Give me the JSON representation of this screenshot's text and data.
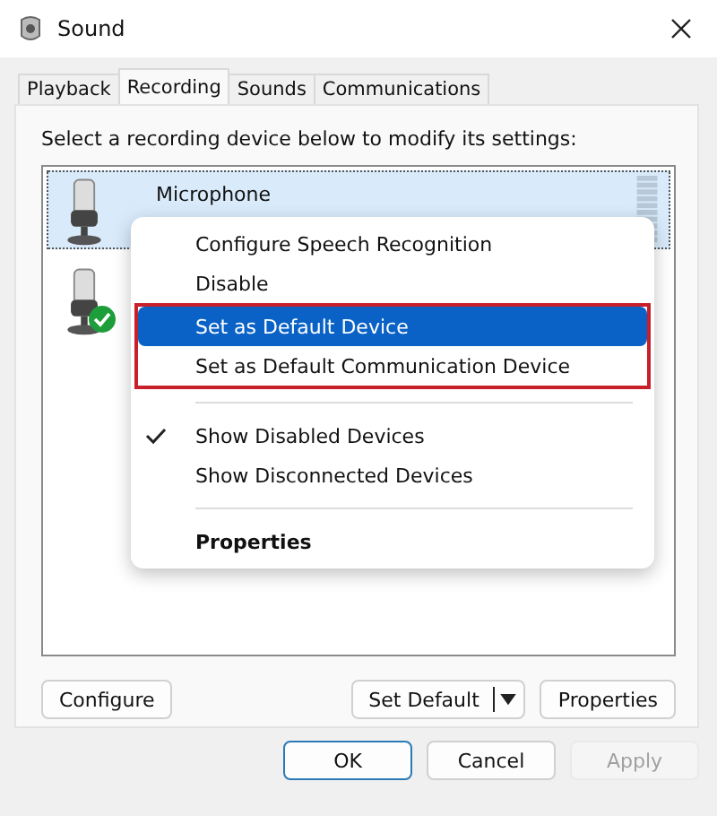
{
  "window": {
    "title": "Sound"
  },
  "tabs": [
    {
      "label": "Playback",
      "selected": false
    },
    {
      "label": "Recording",
      "selected": true
    },
    {
      "label": "Sounds",
      "selected": false
    },
    {
      "label": "Communications",
      "selected": false
    }
  ],
  "instruction": "Select a recording device below to modify its settings:",
  "devices": [
    {
      "name": "Microphone",
      "selected": true,
      "default": false
    },
    {
      "selected": false,
      "default": true
    }
  ],
  "context_menu": [
    {
      "kind": "item",
      "label": "Configure Speech Recognition",
      "selected": false,
      "checked": false,
      "default": false,
      "outlined": false
    },
    {
      "kind": "item",
      "label": "Disable",
      "selected": false,
      "checked": false,
      "default": false,
      "outlined": false
    },
    {
      "kind": "item",
      "label": "Set as Default Device",
      "selected": true,
      "checked": false,
      "default": false,
      "outlined": true
    },
    {
      "kind": "item",
      "label": "Set as Default Communication Device",
      "selected": false,
      "checked": false,
      "default": false,
      "outlined": true
    },
    {
      "kind": "separator"
    },
    {
      "kind": "item",
      "label": "Show Disabled Devices",
      "selected": false,
      "checked": true,
      "default": false,
      "outlined": false
    },
    {
      "kind": "item",
      "label": "Show Disconnected Devices",
      "selected": false,
      "checked": false,
      "default": false,
      "outlined": false
    },
    {
      "kind": "separator"
    },
    {
      "kind": "item",
      "label": "Properties",
      "selected": false,
      "checked": false,
      "default": true,
      "outlined": false
    }
  ],
  "panel_buttons": {
    "configure": "Configure",
    "set_default": "Set Default",
    "properties": "Properties"
  },
  "dialog_buttons": [
    {
      "label": "OK",
      "disabled": false,
      "default": true
    },
    {
      "label": "Cancel",
      "disabled": false,
      "default": false
    },
    {
      "label": "Apply",
      "disabled": true,
      "default": false
    }
  ]
}
